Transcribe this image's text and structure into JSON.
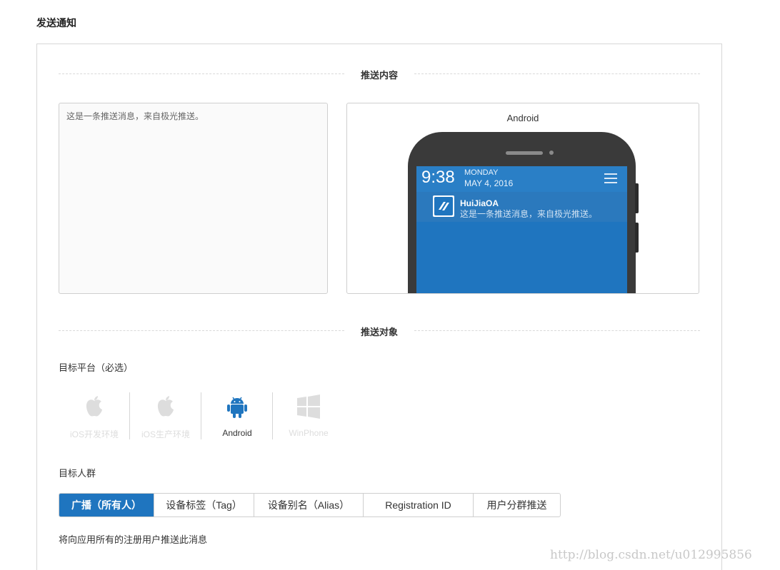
{
  "page": {
    "title": "发送通知"
  },
  "content_section": {
    "heading": "推送内容",
    "message": "这是一条推送消息，来自极光推送。"
  },
  "preview": {
    "platform_label": "Android",
    "time": "9:38",
    "day": "MONDAY",
    "date": "MAY 4, 2016",
    "app_name": "HuiJiaOA",
    "notification_text": "这是一条推送消息，来自极光推送。",
    "screen_color": "#1f75bf"
  },
  "target_section": {
    "heading": "推送对象",
    "platform_label": "目标平台（必选）",
    "platforms": [
      {
        "label": "iOS开发环境",
        "icon": "apple-icon",
        "selected": false
      },
      {
        "label": "iOS生产环境",
        "icon": "apple-icon",
        "selected": false
      },
      {
        "label": "Android",
        "icon": "android-icon",
        "selected": true
      },
      {
        "label": "WinPhone",
        "icon": "windows-icon",
        "selected": false
      }
    ],
    "audience_label": "目标人群",
    "audience_tabs": [
      {
        "label": "广播（所有人）",
        "selected": true
      },
      {
        "label": "设备标签（Tag）",
        "selected": false
      },
      {
        "label": "设备别名（Alias）",
        "selected": false
      },
      {
        "label": "Registration ID",
        "selected": false
      },
      {
        "label": "用户分群推送",
        "selected": false
      }
    ],
    "audience_hint": "将向应用所有的注册用户推送此消息"
  },
  "watermark": "http://blog.csdn.net/u012995856",
  "colors": {
    "accent": "#1f75bf",
    "android": "#1f75bf",
    "disabled_icon": "#dddddd"
  }
}
